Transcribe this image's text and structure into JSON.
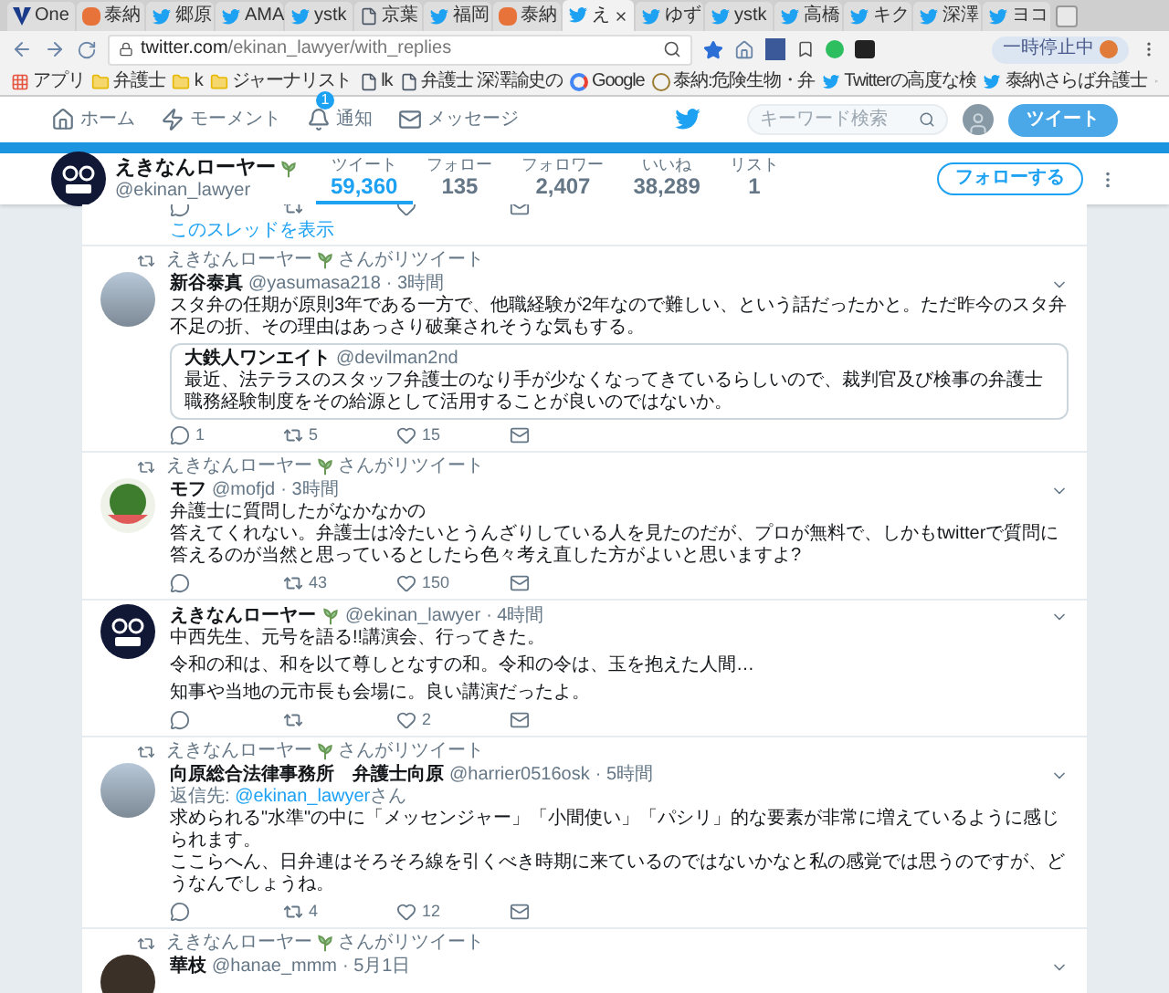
{
  "browser": {
    "tabs": [
      {
        "kind": "v",
        "title": "One",
        "selected": false
      },
      {
        "kind": "blog",
        "title": "泰納",
        "selected": false
      },
      {
        "kind": "bird",
        "title": "郷原",
        "selected": false
      },
      {
        "kind": "bird",
        "title": "AMA",
        "selected": false
      },
      {
        "kind": "bird",
        "title": "ystk",
        "selected": false
      },
      {
        "kind": "page",
        "title": "京葉",
        "selected": false
      },
      {
        "kind": "bird",
        "title": "福岡",
        "selected": false
      },
      {
        "kind": "blog",
        "title": "泰納",
        "selected": false
      },
      {
        "kind": "bird",
        "title": "え",
        "selected": true
      },
      {
        "kind": "bird",
        "title": "ゆず",
        "selected": false
      },
      {
        "kind": "bird",
        "title": "ystk",
        "selected": false
      },
      {
        "kind": "bird",
        "title": "高橋",
        "selected": false
      },
      {
        "kind": "bird",
        "title": "キク",
        "selected": false
      },
      {
        "kind": "bird",
        "title": "深澤",
        "selected": false
      },
      {
        "kind": "bird",
        "title": "ヨコ",
        "selected": false
      }
    ],
    "url_host": "twitter.com",
    "url_path": "/ekinan_lawyer/with_replies",
    "pause_label": "一時停止中",
    "bookmarks": [
      {
        "kind": "apps",
        "label": "アプリ"
      },
      {
        "kind": "folder",
        "label": "弁護士"
      },
      {
        "kind": "folder",
        "label": "k"
      },
      {
        "kind": "folder",
        "label": "ジャーナリスト"
      },
      {
        "kind": "page",
        "label": "lk"
      },
      {
        "kind": "page",
        "label": "弁護士 深澤諭史の"
      },
      {
        "kind": "google",
        "label": "Google"
      },
      {
        "kind": "custom",
        "label": "泰納:危険生物・弁"
      },
      {
        "kind": "bird",
        "label": "Twitterの高度な検"
      },
      {
        "kind": "bird",
        "label": "泰納\\さらば弁護士"
      }
    ]
  },
  "nav": {
    "items": [
      {
        "kind": "home",
        "label": "ホーム"
      },
      {
        "kind": "moment",
        "label": "モーメント"
      },
      {
        "kind": "bell",
        "label": "通知",
        "badge": "1"
      },
      {
        "kind": "mail",
        "label": "メッセージ"
      }
    ],
    "search_placeholder": "キーワード検索",
    "tweet_button": "ツイート"
  },
  "profile": {
    "name": "えきなんローヤー",
    "handle": "@ekinan_lawyer",
    "stats": [
      {
        "label": "ツイート",
        "value": "59,360",
        "selected": true
      },
      {
        "label": "フォロー",
        "value": "135",
        "selected": false
      },
      {
        "label": "フォロワー",
        "value": "2,407",
        "selected": false
      },
      {
        "label": "いいね",
        "value": "38,289",
        "selected": false
      },
      {
        "label": "リスト",
        "value": "1",
        "selected": false
      }
    ],
    "follow_button": "フォローする"
  },
  "thread_link": "このスレッドを表示",
  "tweets": [
    {
      "retweet": {
        "name": "えきなんローヤー",
        "suffix": "さんがリツイート"
      },
      "avatar": {
        "kind": "photo"
      },
      "author": "新谷泰真",
      "plant": false,
      "handle": "@yasumasa218",
      "time": "· 3時間",
      "paragraphs": [
        "スタ弁の任期が原則3年である一方で、他職経験が2年なので難しい、という話だったかと。ただ昨今のスタ弁不足の折、その理由はあっさり破棄されそうな気もする。"
      ],
      "quote": {
        "author": "大鉄人ワンエイト",
        "handle": "@devilman2nd",
        "text": "最近、法テラスのスタッフ弁護士のなり手が少なくなってきているらしいので、裁判官及び検事の弁護士職務経験制度をその給源として活用することが良いのではないか。"
      },
      "counts": {
        "reply": "1",
        "retweet": "5",
        "like": "15"
      }
    },
    {
      "retweet": {
        "name": "えきなんローヤー",
        "suffix": "さんがリツイート"
      },
      "avatar": {
        "kind": "melon"
      },
      "author": "モフ",
      "plant": false,
      "handle": "@mofjd",
      "time": "· 3時間",
      "paragraph_gap": false,
      "paragraphs": [
        "弁護士に質問したがなかなかの",
        "答えてくれない。弁護士は冷たいとうんざりしている人を見たのだが、プロが無料で、しかもtwitterで質問に答えるのが当然と思っているとしたら色々考え直した方がよいと思いますよ?"
      ],
      "counts": {
        "retweet": "43",
        "like": "150"
      }
    },
    {
      "avatar": {
        "kind": "logo"
      },
      "author": "えきなんローヤー",
      "plant": true,
      "handle": "@ekinan_lawyer",
      "time": "· 4時間",
      "paragraph_gap": true,
      "paragraphs": [
        "中西先生、元号を語る!!講演会、行ってきた。",
        "令和の和は、和を以て尊しとなすの和。令和の令は、玉を抱えた人間…",
        "知事や当地の元市長も会場に。良い講演だったよ。"
      ],
      "counts": {
        "like": "2"
      }
    },
    {
      "retweet": {
        "name": "えきなんローヤー",
        "suffix": "さんがリツイート"
      },
      "avatar": {
        "kind": "photo"
      },
      "author": "向原総合法律事務所　弁護士向原",
      "plant": false,
      "handle": "@harrier0516osk",
      "time": "· 5時間",
      "reply_to": {
        "prefix": "返信先:",
        "link": "@ekinan_lawyer",
        "suffix": "さん"
      },
      "paragraph_gap": false,
      "paragraphs": [
        "求められる\"水準\"の中に「メッセンジャー」「小間使い」「パシリ」的な要素が非常に増えているように感じられます。",
        "ここらへん、日弁連はそろそろ線を引くべき時期に来ているのではないかなと私の感覚では思うのですが、どうなんでしょうね。"
      ],
      "counts": {
        "retweet": "4",
        "like": "12"
      }
    },
    {
      "retweet": {
        "name": "えきなんローヤー",
        "suffix": "さんがリツイート"
      },
      "avatar": {
        "kind": "dark"
      },
      "author": "華枝",
      "plant": false,
      "handle": "@hanae_mmm",
      "time": "· 5月1日"
    }
  ]
}
